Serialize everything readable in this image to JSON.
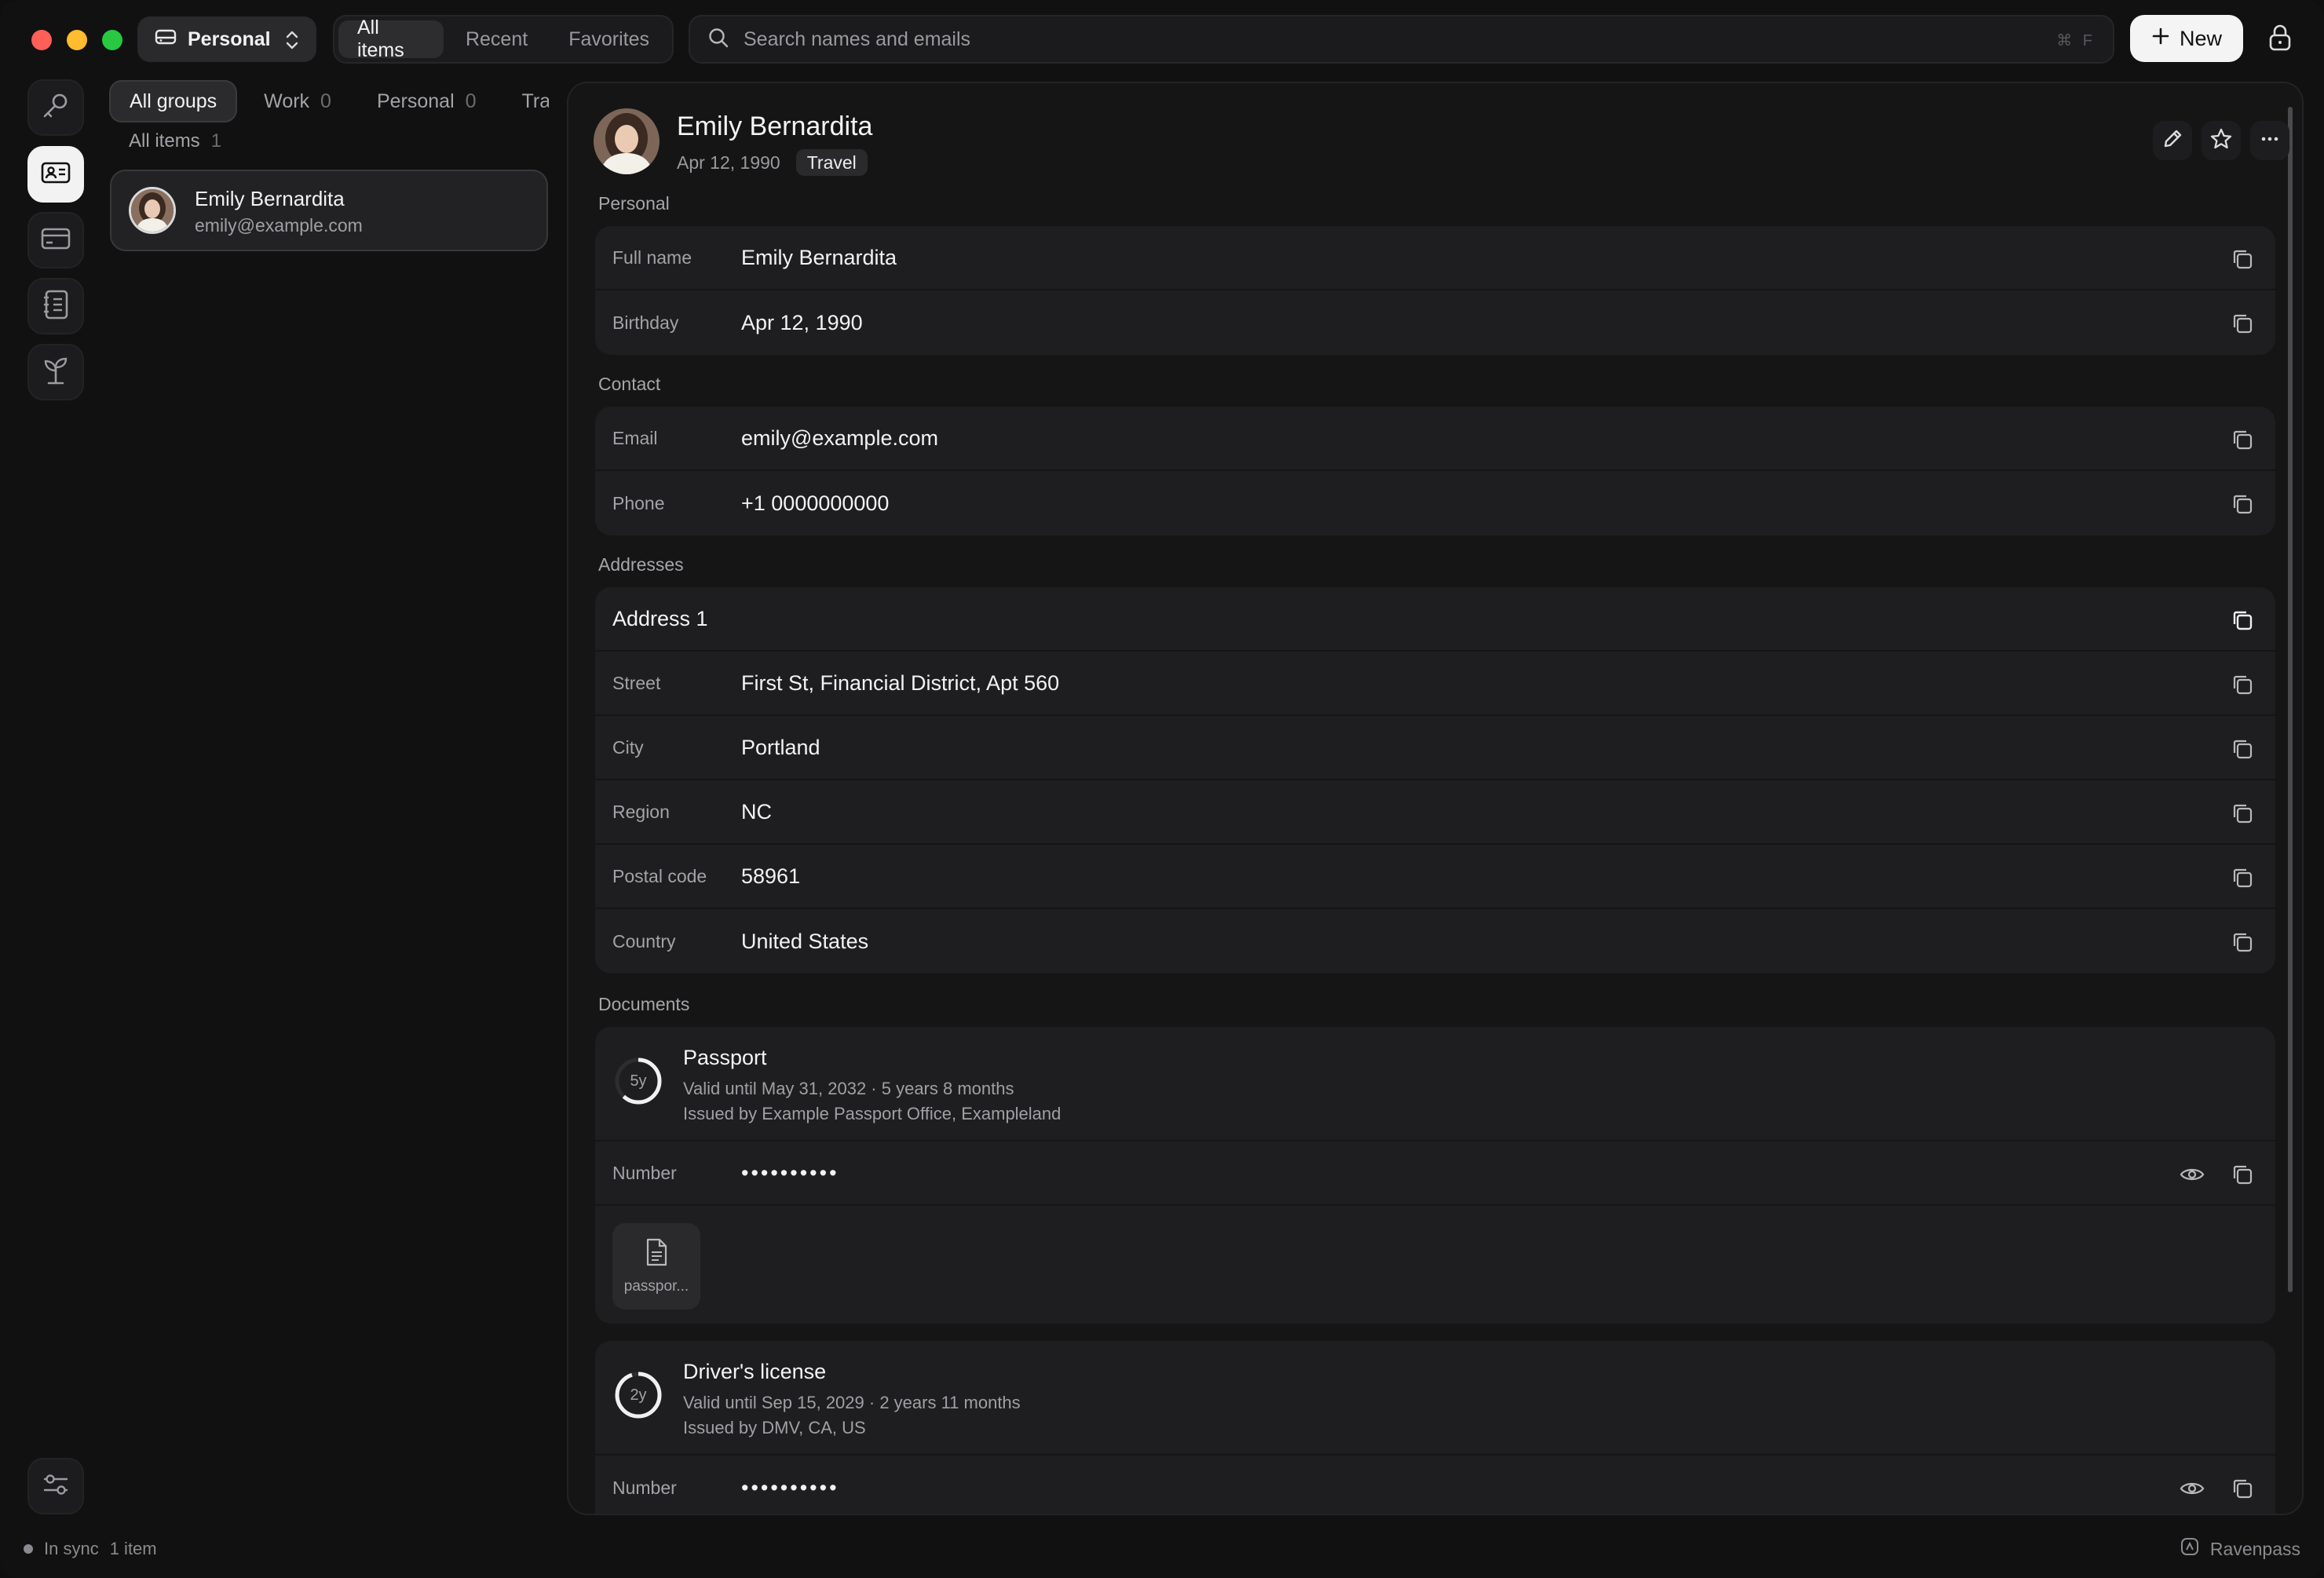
{
  "vault": {
    "name": "Personal"
  },
  "filters": {
    "tabs": [
      "All items",
      "Recent",
      "Favorites"
    ],
    "active": 0
  },
  "search": {
    "placeholder": "Search names and emails",
    "shortcut": "⌘ F"
  },
  "toolbar": {
    "new_label": "New"
  },
  "groups": [
    {
      "label": "All groups",
      "count": ""
    },
    {
      "label": "Work",
      "count": "0"
    },
    {
      "label": "Personal",
      "count": "0"
    },
    {
      "label": "Travel",
      "count": ""
    }
  ],
  "list": {
    "header": "All items",
    "count": "1",
    "items": [
      {
        "name": "Emily Bernardita",
        "email": "emily@example.com"
      }
    ]
  },
  "detail": {
    "name": "Emily Bernardita",
    "birthday": "Apr 12, 1990",
    "tag": "Travel",
    "sections": {
      "personal": {
        "label": "Personal",
        "rows": [
          {
            "label": "Full name",
            "value": "Emily Bernardita"
          },
          {
            "label": "Birthday",
            "value": "Apr 12, 1990"
          }
        ]
      },
      "contact": {
        "label": "Contact",
        "rows": [
          {
            "label": "Email",
            "value": "emily@example.com"
          },
          {
            "label": "Phone",
            "value": "+1 0000000000"
          }
        ]
      },
      "addresses": {
        "label": "Addresses",
        "title": "Address 1",
        "rows": [
          {
            "label": "Street",
            "value": "First St, Financial District, Apt 560"
          },
          {
            "label": "City",
            "value": "Portland"
          },
          {
            "label": "Region",
            "value": "NC"
          },
          {
            "label": "Postal code",
            "value": "58961"
          },
          {
            "label": "Country",
            "value": "United States"
          }
        ]
      },
      "documents": {
        "label": "Documents",
        "items": [
          {
            "title": "Passport",
            "ring": "5y",
            "ring_progress": 0.62,
            "valid": "Valid until May 31, 2032 · 5 years 8 months",
            "issued": "Issued by Example Passport Office, Exampleland",
            "number_label": "Number",
            "number_mask": "••••••••••",
            "attachment": "passpor..."
          },
          {
            "title": "Driver's license",
            "ring": "2y",
            "ring_progress": 0.95,
            "valid": "Valid until Sep 15, 2029 · 2 years 11 months",
            "issued": "Issued by DMV, CA, US",
            "number_label": "Number",
            "number_mask": "••••••••••"
          }
        ]
      }
    }
  },
  "status": {
    "sync": "In sync",
    "count": "1 item",
    "brand": "Ravenpass"
  },
  "colors": {
    "background": "#111112",
    "panel": "#151516",
    "card": "#1e1e20",
    "accent": "#f4f4f5"
  }
}
